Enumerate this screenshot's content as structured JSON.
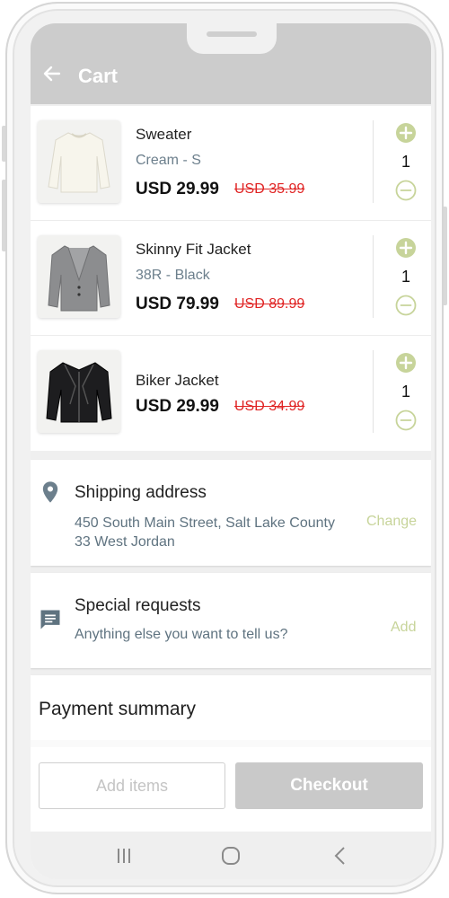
{
  "header": {
    "title": "Cart",
    "back_icon": "arrow-left-icon"
  },
  "cart_items": [
    {
      "name": "Sweater",
      "variant": "Cream - S",
      "price": "USD 29.99",
      "old_price": "USD 35.99",
      "quantity": "1",
      "image": "sweater-image"
    },
    {
      "name": "Skinny Fit Jacket",
      "variant": "38R - Black",
      "price": "USD 79.99",
      "old_price": "USD 89.99",
      "quantity": "1",
      "image": "blazer-image"
    },
    {
      "name": "Biker Jacket",
      "variant": "",
      "price": "USD 29.99",
      "old_price": "USD 34.99",
      "quantity": "1",
      "image": "leather-jacket-image"
    }
  ],
  "shipping": {
    "title": "Shipping address",
    "address_line1": "450 South Main Street, Salt Lake County",
    "address_line2": "33 West Jordan",
    "action": "Change",
    "icon": "location-pin-icon"
  },
  "requests": {
    "title": "Special requests",
    "subtitle": "Anything else you want to tell us?",
    "action": "Add",
    "icon": "chat-icon"
  },
  "payment": {
    "title": "Payment summary",
    "add_items_label": "Add items",
    "checkout_label": "Checkout"
  },
  "colors": {
    "accent": "#c7d49a",
    "header_bg": "#cccccc",
    "old_price": "#e02424",
    "secondary_text": "#5f7380",
    "checkout_bg": "#c9c9c9"
  }
}
